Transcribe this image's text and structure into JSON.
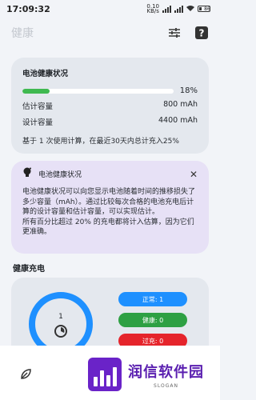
{
  "status_bar": {
    "time": "17:09:32",
    "net_speed": "0.10\nKB/s",
    "battery": "86"
  },
  "app_bar": {
    "title": "健康"
  },
  "battery_health": {
    "heading": "电池健康状况",
    "progress_percent_label": "18%",
    "progress_fraction": 0.18,
    "estimated_label": "估计容量",
    "estimated_value": "800 mAh",
    "design_label": "设计容量",
    "design_value": "4400 mAh",
    "note": "基于 1 次使用计算，在最近30天内总计充入25%"
  },
  "info_card": {
    "heading": "电池健康状况",
    "close": "✕",
    "body": "电池健康状况可以向您显示电池随着时间的推移损失了多少容量（mAh）。通过比较每次合格的电池充电后计算的设计容量和估计容量，可以实现估计。\n所有百分比超过 20% 的充电都将计入估算，因为它们更准确。"
  },
  "healthy_charging": {
    "title": "健康充电",
    "ring_count": "1",
    "pills": [
      {
        "label": "正常: 1",
        "color": "#1e90ff"
      },
      {
        "label": "健康: 0",
        "color": "#2ea043"
      },
      {
        "label": "过充: 0",
        "color": "#e5242b"
      }
    ]
  },
  "watermark": {
    "name": "润信软件园",
    "slogan": "SLOGAN"
  },
  "colors": {
    "accent": "#1e90ff",
    "progress": "#3fb950",
    "brand": "#6a23c8"
  }
}
